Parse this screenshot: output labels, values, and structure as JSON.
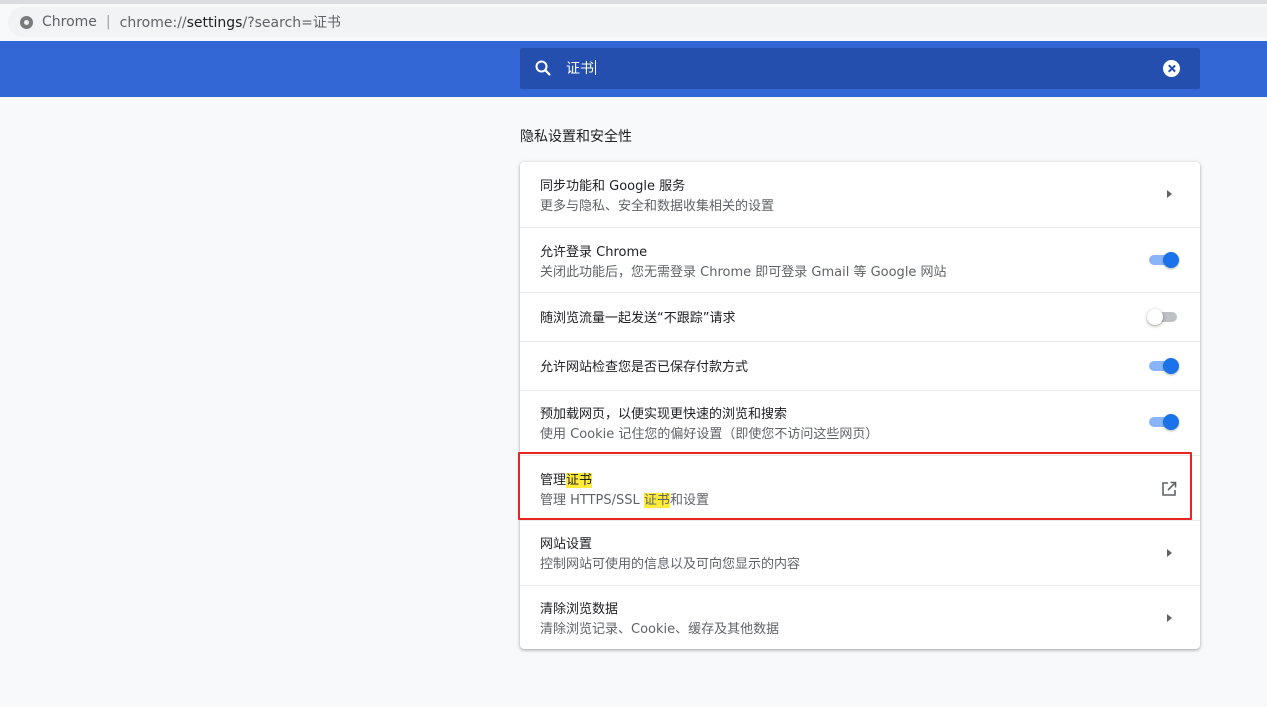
{
  "browser": {
    "label": "Chrome",
    "url_scheme": "chrome://",
    "url_host": "settings",
    "url_rest": "/?search=证书"
  },
  "search": {
    "query": "证书"
  },
  "section": {
    "title": "隐私设置和安全性"
  },
  "rows": [
    {
      "label": "同步功能和 Google 服务",
      "sub": "更多与隐私、安全和数据收集相关的设置",
      "control": "arrow"
    },
    {
      "label": "允许登录 Chrome",
      "sub": "关闭此功能后，您无需登录 Chrome 即可登录 Gmail 等 Google 网站",
      "control": "toggle",
      "on": true
    },
    {
      "label": "随浏览流量一起发送“不跟踪”请求",
      "sub": "",
      "control": "toggle",
      "on": false
    },
    {
      "label": "允许网站检查您是否已保存付款方式",
      "sub": "",
      "control": "toggle",
      "on": true
    },
    {
      "label": "预加载网页，以便实现更快速的浏览和搜索",
      "sub": "使用 Cookie 记住您的偏好设置（即使您不访问这些网页）",
      "control": "toggle",
      "on": true
    },
    {
      "label_pre": "管理",
      "label_hl": "证书",
      "sub_pre": "管理 HTTPS/SSL ",
      "sub_hl": "证书",
      "sub_post": "和设置",
      "control": "external-link"
    },
    {
      "label": "网站设置",
      "sub": "控制网站可使用的信息以及可向您显示的内容",
      "control": "arrow"
    },
    {
      "label": "清除浏览数据",
      "sub": "清除浏览记录、Cookie、缓存及其他数据",
      "control": "arrow"
    }
  ],
  "colors": {
    "header_blue": "#3367d6",
    "search_blue": "#254fae",
    "toggle_on": "#1a73e8",
    "highlight": "#ffeb3b",
    "annotation_red": "#e8251e"
  }
}
